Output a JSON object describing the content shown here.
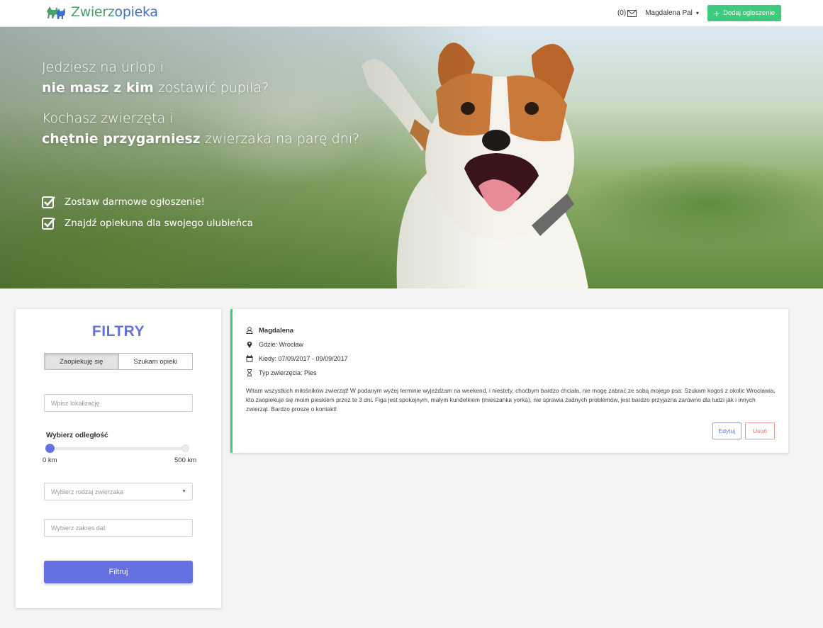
{
  "brand": {
    "name_part1": "Zwierz",
    "name_part2": "opieka",
    "icon": "dog-cat-logo-icon",
    "color_green": "#4a9e6a",
    "color_blue": "#3b6fc9"
  },
  "nav": {
    "messages_count": "(0)",
    "messages_icon": "envelope-icon",
    "user_name": "Magdalena Pal",
    "user_caret": "▾",
    "add_button_plus": "+",
    "add_button_label": "Dodaj ogłoszenie"
  },
  "hero": {
    "line1": "Jedziesz na urlop i",
    "line2_bold": "nie masz z kim",
    "line2_rest": " zostawić pupila?",
    "line3": "Kochasz zwierzęta i",
    "line4_bold": "chętnie przygarniesz",
    "line4_rest": " zwierzaka na parę dni?",
    "checks": [
      "Zostaw darmowe ogłoszenie!",
      "Znajdź opiekuna dla swojego ulubieńca"
    ],
    "check_icon": "checkbox-checked-icon"
  },
  "filters": {
    "title": "FILTRY",
    "tabs": [
      {
        "label": "Zaopiekuję się",
        "active": true
      },
      {
        "label": "Szukam opieki",
        "active": false
      }
    ],
    "location_placeholder": "Wpisz lokalizację",
    "distance_label": "Wybierz odległość",
    "distance_value_fraction": 0,
    "distance_min": "0 km",
    "distance_max": "500 km",
    "animal_select_placeholder": "Wybierz rodzaj zwierzaka",
    "date_placeholder": "Wybierz zakres dat",
    "submit_label": "Filtruj",
    "accent": "#6571e0"
  },
  "ad": {
    "author": "Magdalena",
    "location": "Gdzie: Wrocław",
    "dates": "Kiedy: 07/09/2017 - 09/09/2017",
    "animal_type": "Typ zwierzęcia: Pies",
    "description": "Witam wszystkich miłośników zwierząt! W podanym wyżej terminie wyjeżdżam na weekend, i niestety, choćbym bardzo chciała, nie mogę zabrać ze sobą mojego psa. Szukam kogoś z okolic Wrocławia, kto zaopiekuje się moim pieskiem przez te 3 dni. Figa jest spokojnym, małym kundelkiem (mieszanka yorka), nie sprawia żadnych problemów, jest bardzo przyjazna zarówno dla ludzi jak i innych zwierząt. Bardzo proszę o kontakt!",
    "edit_label": "Edytuj",
    "delete_label": "Usuń",
    "accent": "#3dcb7e"
  }
}
